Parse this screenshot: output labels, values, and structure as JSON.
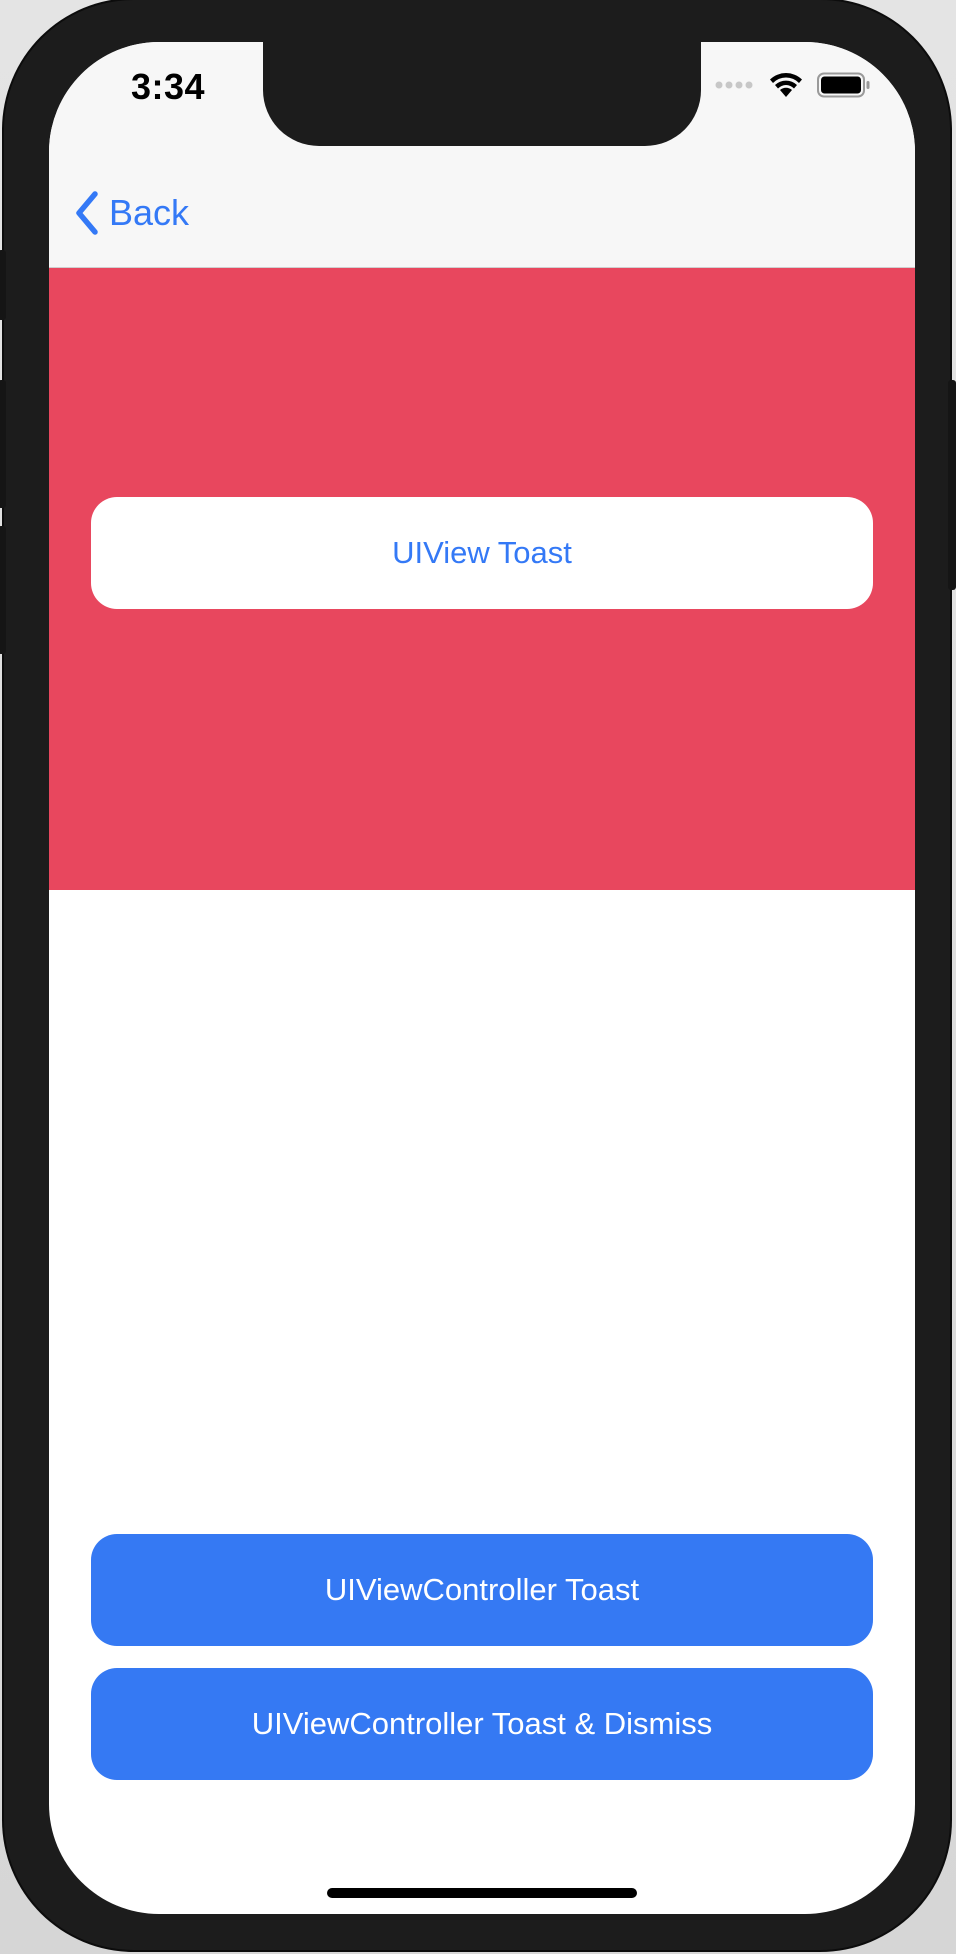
{
  "status_bar": {
    "time": "3:34"
  },
  "nav": {
    "back_label": "Back"
  },
  "buttons": {
    "uiview_toast": "UIView Toast",
    "vc_toast": "UIViewController Toast",
    "vc_toast_dismiss": "UIViewController Toast & Dismiss"
  },
  "colors": {
    "accent": "#3479f6",
    "panel_red": "#e8475e",
    "button_blue": "#3579f3"
  },
  "icons": [
    "chevron-left-icon",
    "signal-icon",
    "wifi-icon",
    "battery-icon"
  ]
}
